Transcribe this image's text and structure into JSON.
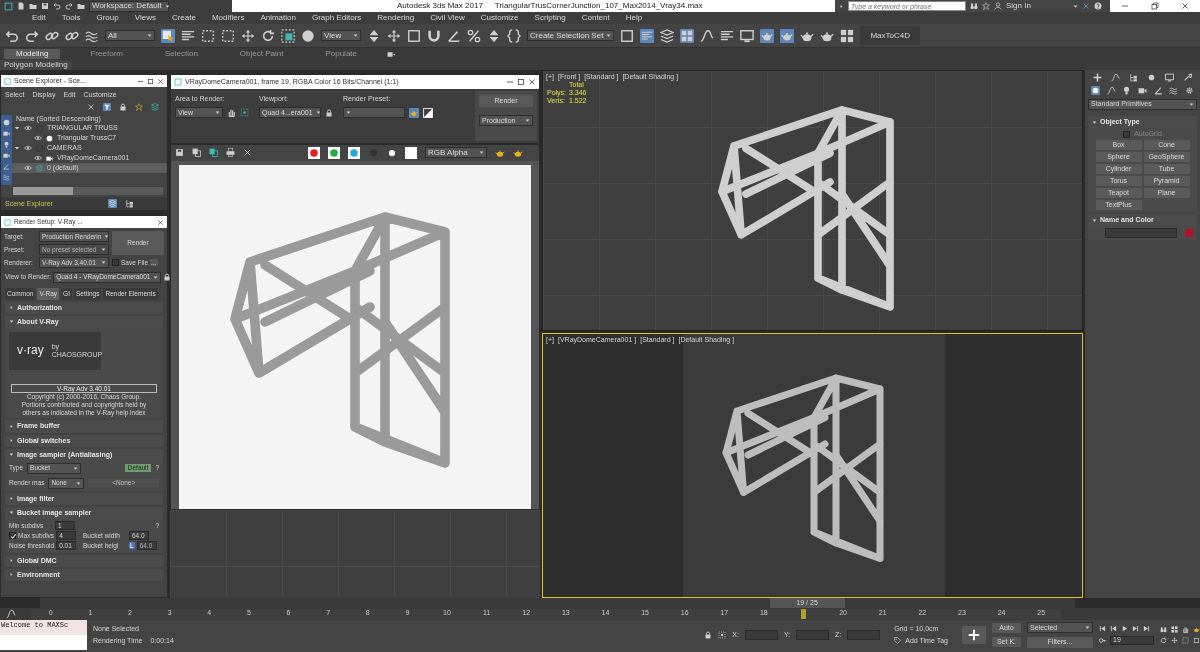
{
  "title_bar": {
    "workspace": "Workspace: Default",
    "app_title": "Autodesk 3ds Max 2017",
    "file_name": "TriangularTrusCornerJunction_107_Max2014_Vray34.max",
    "search": {
      "placeholder": "Type a keyword or phrase"
    },
    "sign_in": "Sign In"
  },
  "menu": [
    "Edit",
    "Tools",
    "Group",
    "Views",
    "Create",
    "Modifiers",
    "Animation",
    "Graph Editors",
    "Rendering",
    "Civil View",
    "Customize",
    "Scripting",
    "Content",
    "Help"
  ],
  "main_toolbar": {
    "selection_filter": "All",
    "reference_coordinate": "View",
    "selection_set": "Create Selection Set",
    "plugin_button": "MaxToC4D"
  },
  "ribbon": {
    "tabs": [
      {
        "label": "Modeling",
        "selected": true
      },
      {
        "label": "Freeform",
        "selected": false
      },
      {
        "label": "Selection",
        "selected": false
      },
      {
        "label": "Object Paint",
        "selected": false
      },
      {
        "label": "Populate",
        "selected": false
      }
    ],
    "panel_label": "Polygon Modeling"
  },
  "scene_explorer": {
    "title": "Scene Explorer - Sce...",
    "menu": [
      "Select",
      "Display",
      "Edit",
      "Customize"
    ],
    "column_header": "Name (Sorted Descending)",
    "tree": [
      {
        "label": "TRIANGULAR TRUSS",
        "kind": "layer",
        "selected": false,
        "expanded": true,
        "children": [
          {
            "label": "Triangular TrussC7",
            "kind": "object",
            "selected": false
          }
        ]
      },
      {
        "label": "CAMERAS",
        "kind": "layer",
        "selected": false,
        "expanded": true,
        "children": [
          {
            "label": "VRayDomeCamera001",
            "kind": "camera",
            "selected": false
          }
        ]
      },
      {
        "label": "0 (default)",
        "kind": "default_layer",
        "selected": true
      }
    ],
    "footer": "Scene Explorer"
  },
  "render_setup": {
    "title": "Render Setup: V-Ray ...",
    "target": {
      "label": "Target:",
      "value": "Production Renderin",
      "disabled": false
    },
    "preset": {
      "label": "Preset:",
      "value": "No preset selected",
      "disabled": true
    },
    "renderer": {
      "label": "Renderer:",
      "value": "V-Ray Adv 3.40.01",
      "disabled": false
    },
    "render_button": "Render",
    "save_file": {
      "label": "Save File",
      "checked": false
    },
    "more": "...",
    "view": {
      "label": "View to Render:",
      "value": "Quad 4 - VRayDomeCamera001",
      "disabled": false
    },
    "tabs": [
      {
        "label": "Common",
        "selected": false
      },
      {
        "label": "V-Ray",
        "selected": true
      },
      {
        "label": "GI",
        "selected": false
      },
      {
        "label": "Settings",
        "selected": false
      },
      {
        "label": "Render Elements",
        "selected": false
      }
    ],
    "rollouts": [
      {
        "title": "Authorization",
        "expanded": false
      },
      {
        "kind": "about",
        "title": "About V-Ray",
        "expanded": true,
        "logo": "v·ray",
        "logo_by": "by",
        "logo_company": "CHAOSGROUP",
        "version": "V-Ray Adv 3.40.01",
        "copyright": "Copyright (c) 2000-2016, Chaos Group. Portions contributed and copyrights held by others as indicated in the V-Ray help index"
      },
      {
        "title": "Frame buffer",
        "expanded": false
      },
      {
        "title": "Global switches",
        "expanded": false
      },
      {
        "kind": "image_sampler",
        "title": "Image sampler (Antialiasing)",
        "expanded": true,
        "type_label": "Type",
        "type_value": "Bucket",
        "default_badge": "Default",
        "help": "?",
        "mask_label": "Render mas",
        "mask_value": "None",
        "mask_object": "<None>"
      },
      {
        "title": "Image filter",
        "expanded": false
      },
      {
        "kind": "bucket",
        "title": "Bucket image sampler",
        "expanded": true,
        "help": "?",
        "rows": [
          [
            {
              "kind": "spinner",
              "label": "Min subdivs",
              "value": "1"
            }
          ],
          [
            {
              "kind": "check",
              "label": "Max subdivs",
              "value": "4",
              "checked": true
            },
            {
              "kind": "spinner",
              "label": "Bucket width",
              "value": "64.0"
            }
          ],
          [
            {
              "kind": "spinner",
              "label": "Noise threshold",
              "value": "0.01"
            },
            {
              "kind": "locked",
              "label": "Bucket heigl",
              "lock": "L",
              "value": "64.0"
            }
          ]
        ]
      },
      {
        "title": "Global DMC",
        "expanded": false
      },
      {
        "title": "Environment",
        "expanded": false
      }
    ]
  },
  "frame_buffer": {
    "title": "VRayDomeCamera001, frame 19, RGBA Color 16 Bits/Channel (1:1)",
    "area": {
      "label": "Area to Render:",
      "value": "View"
    },
    "viewport": {
      "label": "Viewport:",
      "value": "Quad 4...era001"
    },
    "preset": {
      "label": "Render Preset:"
    },
    "render_button": "Render",
    "mode": "Production",
    "channels": [
      {
        "color": "#e02020"
      },
      {
        "color": "#20b040"
      },
      {
        "color": "#20a8d8"
      }
    ],
    "display": "RGB Alpha"
  },
  "viewports": [
    {
      "kind": "orthographic",
      "selected": false,
      "labels": [
        "[+]",
        "[Front ]",
        "[Standard ]",
        "[Default Shading ]"
      ],
      "stats": {
        "title": "Total",
        "rows": [
          {
            "label": "Polys:",
            "value": "3.346"
          },
          {
            "label": "Verts:",
            "value": "1.522"
          }
        ]
      }
    },
    {
      "kind": "camera",
      "selected": true,
      "labels": [
        "[+]",
        "[VRayDomeCamera001 ]",
        "[Standard ]",
        "[Default Shading ]"
      ]
    }
  ],
  "command_panel": {
    "category": "Standard Primitives",
    "rollouts": [
      {
        "kind": "buttons",
        "title": "Object Type",
        "expanded": true,
        "autogrid": {
          "label": "AutoGrid",
          "checked": false
        },
        "buttons": [
          "Box",
          "Cone",
          "Sphere",
          "GeoSphere",
          "Cylinder",
          "Tube",
          "Torus",
          "Pyramid",
          "Teapot",
          "Plane",
          "TextPlus"
        ]
      },
      {
        "kind": "color",
        "title": "Name and Color",
        "expanded": true,
        "color": "#b0122a"
      }
    ]
  },
  "time_slider": {
    "label": "19 / 25",
    "level": 0.76
  },
  "timeline": {
    "ticks": [
      "0",
      "1",
      "2",
      "3",
      "4",
      "5",
      "6",
      "7",
      "8",
      "9",
      "10",
      "11",
      "12",
      "13",
      "14",
      "15",
      "16",
      "17",
      "18",
      "20",
      "21",
      "22",
      "23",
      "24",
      "25"
    ]
  },
  "status_bar": {
    "script_listener": "Welcome to MAXSc",
    "selection": "None Selected",
    "render_time_label": "Rendering Time",
    "render_time": "0:00:14",
    "coords": [
      {
        "label": "X:"
      },
      {
        "label": "Y:"
      },
      {
        "label": "Z:"
      }
    ],
    "grid": "Grid = 10,0cm",
    "time_tag": "Add Time Tag",
    "auto_key": {
      "label": "Auto",
      "on": false
    },
    "key_set": "Selected",
    "set_key": "Set K.",
    "filters": "Filters...",
    "frame": "19"
  }
}
